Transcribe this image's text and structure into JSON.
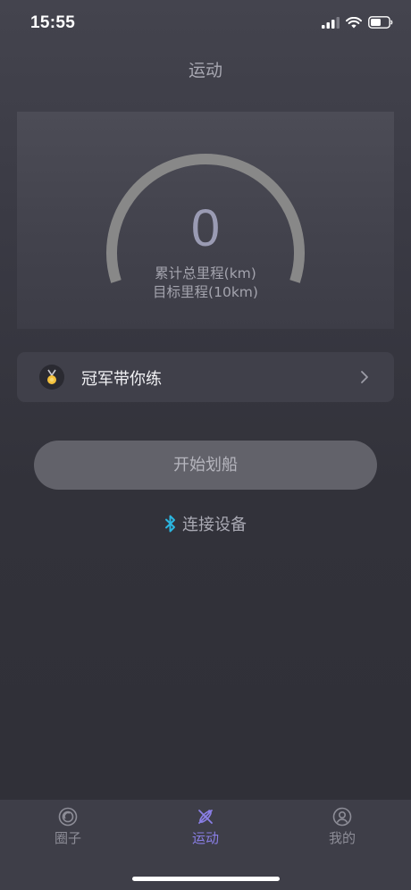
{
  "status_bar": {
    "time": "15:55"
  },
  "header": {
    "title": "运动"
  },
  "gauge": {
    "value": "0",
    "label_total": "累计总里程(km)",
    "label_target": "目标里程(10km)",
    "progress": 0
  },
  "champion": {
    "label": "冠军带你练"
  },
  "actions": {
    "start_label": "开始划船",
    "connect_label": "连接设备"
  },
  "tabbar": {
    "tabs": [
      {
        "label": "圈子",
        "icon": "circle-icon",
        "active": false
      },
      {
        "label": "运动",
        "icon": "rowing-icon",
        "active": true
      },
      {
        "label": "我的",
        "icon": "profile-icon",
        "active": false
      }
    ]
  },
  "colors": {
    "accent": "#8a7fe6",
    "bluetooth": "#2bb6e0",
    "medal": "#f5c23d"
  }
}
